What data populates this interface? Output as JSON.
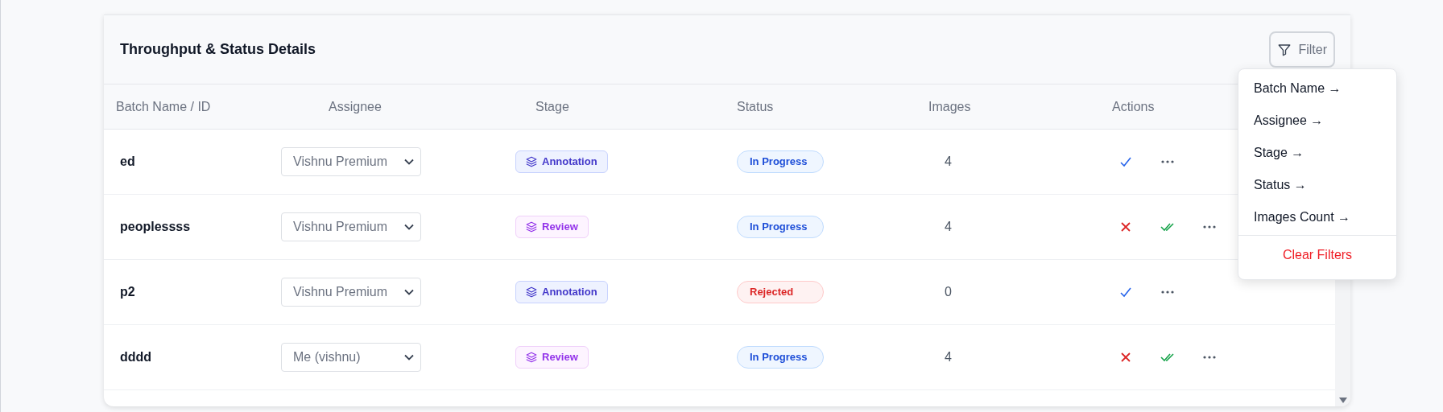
{
  "card": {
    "title": "Throughput & Status Details",
    "filter_button": {
      "label": "Filter"
    }
  },
  "table": {
    "columns": [
      "Batch Name / ID",
      "Assignee",
      "Stage",
      "Status",
      "Images",
      "Actions"
    ],
    "rows": [
      {
        "name": "ed",
        "assignee": "Vishnu Premium",
        "stage": {
          "label": "Annotation",
          "kind": "annotation"
        },
        "status": {
          "label": "In Progress",
          "kind": "progress"
        },
        "images": "4",
        "actions": [
          {
            "kind": "approve"
          },
          {
            "kind": "more"
          }
        ]
      },
      {
        "name": "peoplessss",
        "assignee": "Vishnu Premium",
        "stage": {
          "label": "Review",
          "kind": "review"
        },
        "status": {
          "label": "In Progress",
          "kind": "progress"
        },
        "images": "4",
        "actions": [
          {
            "kind": "reject"
          },
          {
            "kind": "approve_all"
          },
          {
            "kind": "more"
          }
        ]
      },
      {
        "name": "p2",
        "assignee": "Vishnu Premium",
        "stage": {
          "label": "Annotation",
          "kind": "annotation"
        },
        "status": {
          "label": "Rejected",
          "kind": "rejected"
        },
        "images": "0",
        "actions": [
          {
            "kind": "approve"
          },
          {
            "kind": "more"
          }
        ]
      },
      {
        "name": "dddd",
        "assignee": "Me (vishnu)",
        "stage": {
          "label": "Review",
          "kind": "review"
        },
        "status": {
          "label": "In Progress",
          "kind": "progress"
        },
        "images": "4",
        "actions": [
          {
            "kind": "reject"
          },
          {
            "kind": "approve_all"
          },
          {
            "kind": "more"
          }
        ]
      }
    ]
  },
  "filter_menu": {
    "items": [
      "Batch Name →",
      "Assignee →",
      "Stage →",
      "Status →",
      "Images Count →"
    ],
    "clear": "Clear Filters"
  }
}
